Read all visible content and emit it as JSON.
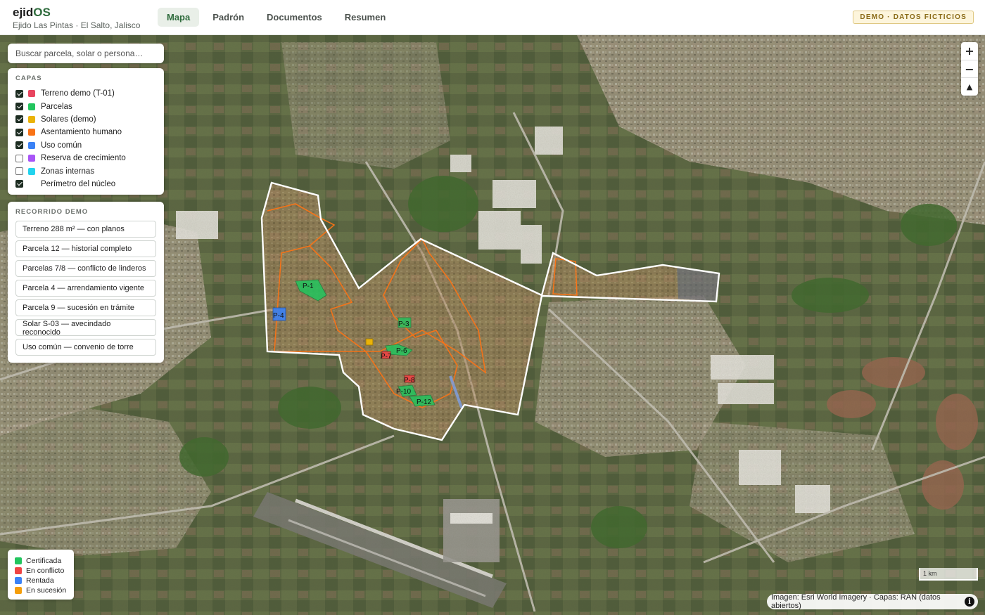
{
  "header": {
    "brand_prefix": "ejid",
    "brand_suffix": "OS",
    "subtitle": "Ejido Las Pintas · El Salto, Jalisco",
    "tabs": [
      {
        "label": "Mapa",
        "active": true
      },
      {
        "label": "Padrón",
        "active": false
      },
      {
        "label": "Documentos",
        "active": false
      },
      {
        "label": "Resumen",
        "active": false
      }
    ],
    "badge": "DEMO · DATOS FICTICIOS"
  },
  "search": {
    "placeholder": "Buscar parcela, solar o persona…"
  },
  "layers": {
    "title": "CAPAS",
    "items": [
      {
        "label": "Terreno demo (T-01)",
        "checked": true,
        "color": "#e8455f"
      },
      {
        "label": "Parcelas",
        "checked": true,
        "color": "#22c55e"
      },
      {
        "label": "Solares (demo)",
        "checked": true,
        "color": "#eab308"
      },
      {
        "label": "Asentamiento humano",
        "checked": true,
        "color": "#f97316"
      },
      {
        "label": "Uso común",
        "checked": true,
        "color": "#3b82f6"
      },
      {
        "label": "Reserva de crecimiento",
        "checked": false,
        "color": "#a855f7"
      },
      {
        "label": "Zonas internas",
        "checked": false,
        "color": "#22d3ee"
      },
      {
        "label": "Perímetro del núcleo",
        "checked": true,
        "color": "#ffffff"
      }
    ]
  },
  "tour": {
    "title": "RECORRIDO DEMO",
    "items": [
      "Terreno 288 m² — con planos",
      "Parcela 12 — historial completo",
      "Parcelas 7/8 — conflicto de linderos",
      "Parcela 4 — arrendamiento vigente",
      "Parcela 9 — sucesión en trámite",
      "Solar S-03 — avecindado reconocido",
      "Uso común — convenio de torre"
    ]
  },
  "legend": {
    "items": [
      {
        "label": "Certificada",
        "color": "#22c55e"
      },
      {
        "label": "En conflicto",
        "color": "#ef4444"
      },
      {
        "label": "Rentada",
        "color": "#3b82f6"
      },
      {
        "label": "En sucesión",
        "color": "#f59e0b"
      }
    ]
  },
  "map": {
    "parcel_labels": [
      "P-1",
      "P-4",
      "P-3",
      "P-6",
      "P-7",
      "P-8",
      "P-10",
      "P-12"
    ],
    "scale_label": "1 km",
    "attribution": "Imagen: Esri World Imagery · Capas: RAN (datos abiertos)",
    "controls": {
      "zoom_in": "+",
      "zoom_out": "−",
      "compass": "▲"
    }
  }
}
